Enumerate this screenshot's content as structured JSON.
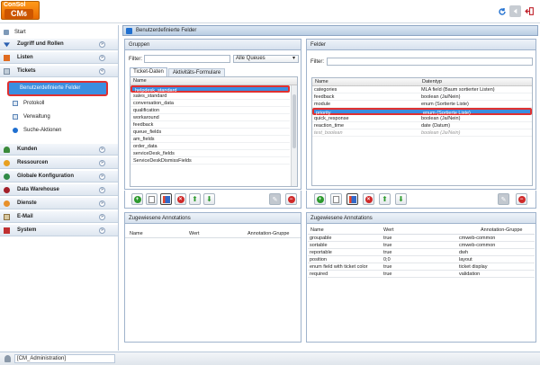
{
  "brand": {
    "top": "ConSol",
    "main": "CM",
    "version": "6"
  },
  "status_user": "[CM_Administration]",
  "sidebar": {
    "start": "Start",
    "sections": [
      {
        "label": "Zugriff und Rollen"
      },
      {
        "label": "Listen"
      },
      {
        "label": "Tickets"
      }
    ],
    "ticket_items": [
      "Benutzerdefinierte Felder",
      "Protokoll",
      "Verwaltung",
      "Suche-Aktionen"
    ],
    "lower_sections": [
      {
        "label": "Kunden"
      },
      {
        "label": "Ressourcen"
      },
      {
        "label": "Globale Konfiguration"
      },
      {
        "label": "Data Warehouse"
      },
      {
        "label": "Dienste"
      },
      {
        "label": "E-Mail"
      },
      {
        "label": "System"
      }
    ]
  },
  "main": {
    "title": "Benutzerdefinierte Felder",
    "groups": {
      "title": "Gruppen",
      "filter_label": "Filter:",
      "queue_select": "Alle Queues",
      "tabs": [
        "Ticket-Daten",
        "Aktivitäts-Formulare"
      ],
      "col": "Name",
      "rows": [
        "helpdesk_standard",
        "sales_standard",
        "conversation_data",
        "qualification",
        "workaround",
        "feedback",
        "queue_fields",
        "am_fields",
        "order_data",
        "serviceDesk_fields",
        "ServiceDeskDismissFields"
      ],
      "annotations": {
        "title": "Zugewiesene Annotations",
        "cols": [
          "Name",
          "Wert",
          "Annotation-Gruppe"
        ]
      }
    },
    "fields": {
      "title": "Felder",
      "filter_label": "Filter:",
      "cols": [
        "Name",
        "Datentyp"
      ],
      "rows": [
        [
          "categories",
          "MLA field (Baum sortierter Listen)"
        ],
        [
          "feedback",
          "boolean (Ja/Nein)"
        ],
        [
          "module",
          "enum (Sortierte Liste)"
        ],
        [
          "priority",
          "enum (Sortierte Liste)"
        ],
        [
          "quick_response",
          "boolean (Ja/Nein)"
        ],
        [
          "reaction_time",
          "date (Datum)"
        ],
        [
          "test_boolean",
          "boolean (Ja/Nein)"
        ]
      ],
      "annotations": {
        "title": "Zugewiesene Annotations",
        "cols": [
          "Name",
          "Wert",
          "Annotation-Gruppe"
        ],
        "rows": [
          [
            "groupable",
            "true",
            "cmweb-common"
          ],
          [
            "sortable",
            "true",
            "cmweb-common"
          ],
          [
            "reportable",
            "true",
            "dwh"
          ],
          [
            "position",
            "0;0",
            "layout"
          ],
          [
            "enum field with ticket color",
            "true",
            "ticket display"
          ],
          [
            "required",
            "true",
            "validation"
          ]
        ]
      }
    }
  }
}
